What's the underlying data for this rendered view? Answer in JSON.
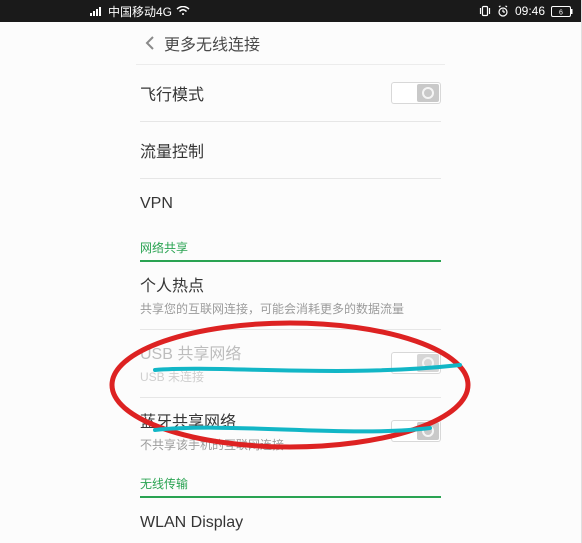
{
  "status_bar": {
    "carrier": "中国移动4G",
    "time": "09:46",
    "battery_level": "6"
  },
  "header": {
    "title": "更多无线连接"
  },
  "rows": {
    "airplane": {
      "label": "飞行模式"
    },
    "data_control": {
      "label": "流量控制"
    },
    "vpn": {
      "label": "VPN"
    }
  },
  "sections": {
    "share": {
      "title": "网络共享"
    },
    "wireless_tx": {
      "title": "无线传输"
    }
  },
  "share_rows": {
    "hotspot": {
      "label": "个人热点",
      "sub": "共享您的互联网连接，可能会消耗更多的数据流量"
    },
    "usb_tether": {
      "label": "USB 共享网络",
      "sub": "USB 未连接"
    },
    "bt_tether": {
      "label": "蓝牙共享网络",
      "sub": "不共享该手机的互联网连接"
    }
  },
  "tx_rows": {
    "wlan_display": {
      "label": "WLAN Display"
    }
  }
}
